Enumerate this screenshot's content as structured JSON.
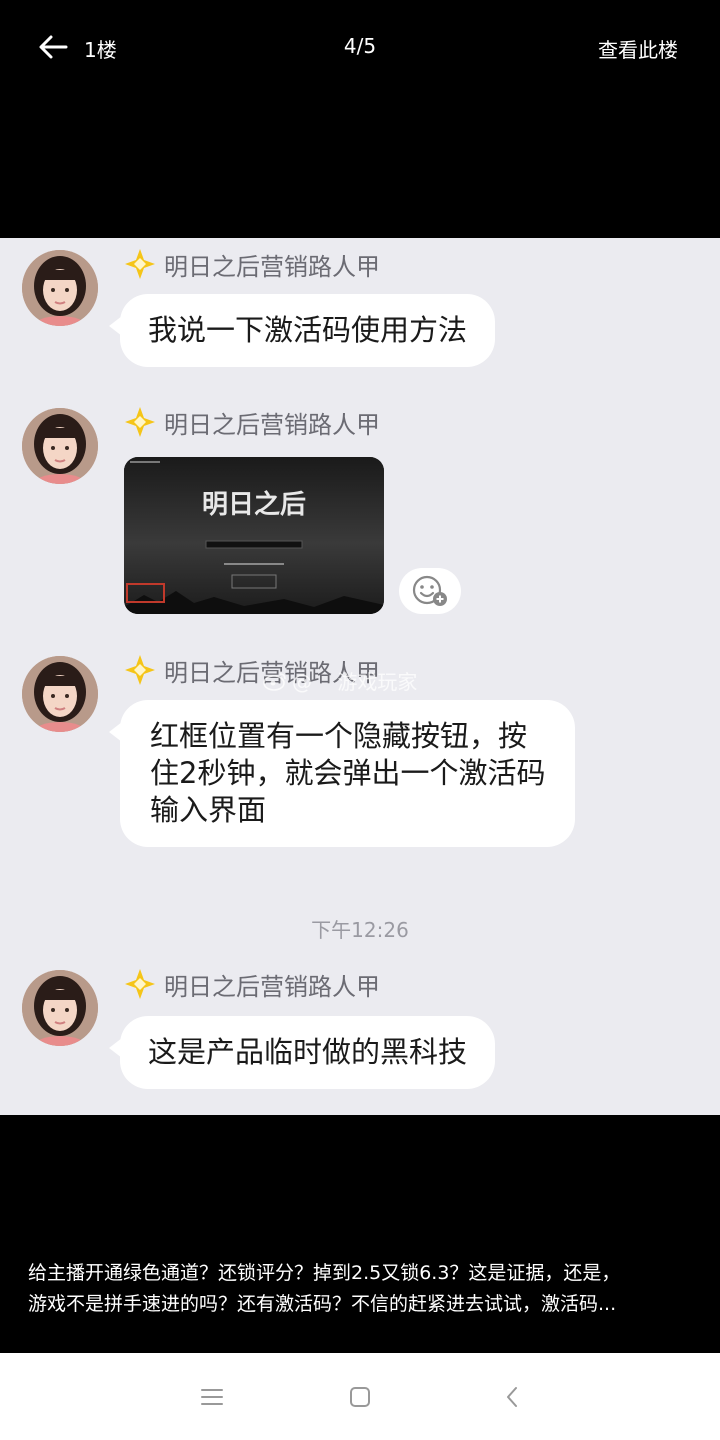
{
  "topbar": {
    "floor_label": "1楼",
    "page_counter": "4/5",
    "view_floor": "查看此楼"
  },
  "chat": {
    "messages": [
      {
        "sender": "明日之后营销路人甲",
        "text": "我说一下激活码使用方法"
      },
      {
        "sender": "明日之后营销路人甲",
        "image": {
          "title": "明日之后"
        }
      },
      {
        "sender": "明日之后营销路人甲",
        "lines": [
          "红框位置有一个隐藏按钮，按",
          "住2秒钟，就会弹出一个激活码",
          "输入界面"
        ]
      },
      {
        "sender": "明日之后营销路人甲",
        "text": "这是产品临时做的黑科技"
      }
    ],
    "timestamp": "下午12:26",
    "watermark": "@    游戏玩家"
  },
  "caption": {
    "line1": "给主播开通绿色通道？还锁评分？掉到2.5又锁6.3？这是证据，还是，",
    "line2": "游戏不是拼手速进的吗？还有激活码？不信的赶紧进去试试，激活码..."
  },
  "icons": {
    "back": "back-arrow-icon",
    "badge": "gold-diamond-badge-icon",
    "emoji": "emoji-add-icon",
    "nav_menu": "menu-icon",
    "nav_home": "home-square-icon",
    "nav_back": "chevron-left-icon"
  },
  "colors": {
    "chat_background": "#ebebf0",
    "bubble": "#ffffff",
    "badge_gold": "#f5c518",
    "sender_name": "#6b6b73",
    "timestamp": "#9a9aa2",
    "highlight_box": "#c0392b"
  }
}
